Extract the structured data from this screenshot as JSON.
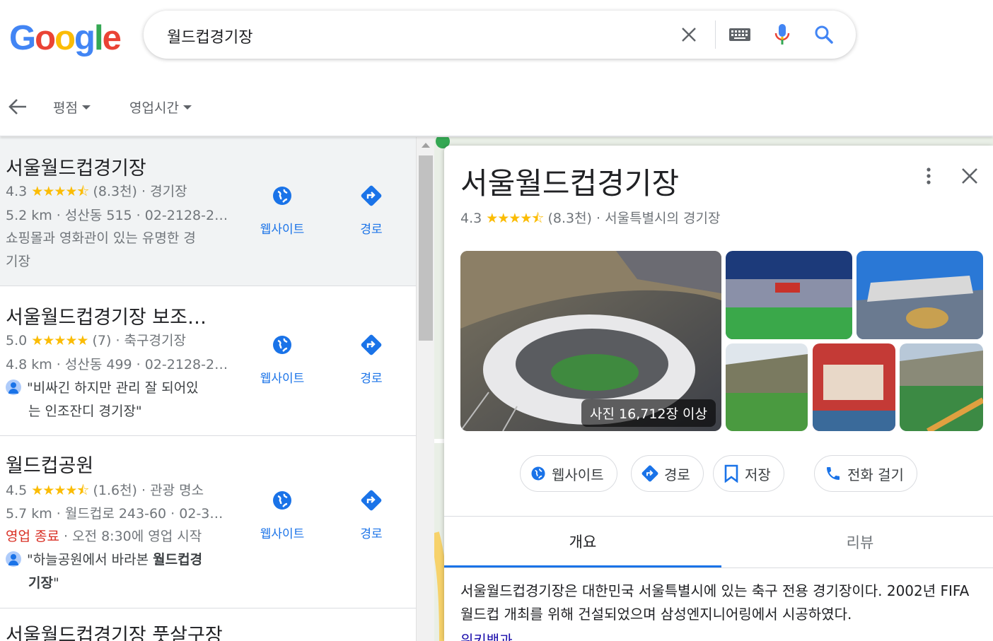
{
  "logo": {
    "letters": [
      "G",
      "o",
      "o",
      "g",
      "l",
      "e"
    ],
    "colors": [
      "#4285f4",
      "#ea4335",
      "#fbbc05",
      "#4285f4",
      "#34a853",
      "#ea4335"
    ]
  },
  "search": {
    "query": "월드컵경기장"
  },
  "filters": [
    {
      "label": "평점"
    },
    {
      "label": "영업시간"
    }
  ],
  "results": [
    {
      "title": "서울월드컵경기장",
      "rating": "4.3",
      "stars": "★★★★⯪",
      "reviews": "(8.3천)",
      "category": "· 경기장",
      "line2": "5.2 km · 성산동 515 · 02-2128-2…",
      "line3": "쇼핑몰과 영화관이 있는 유명한 경",
      "line4": "기장",
      "website": "웹사이트",
      "directions": "경로"
    },
    {
      "title": "서울월드컵경기장 보조…",
      "rating": "5.0",
      "stars": "★★★★★",
      "reviews": "(7)",
      "category": "· 축구경기장",
      "line2": "4.8 km · 성산동 499 · 02-2128-2…",
      "line3": "\"비싸긴 하지만 관리 잘 되어있",
      "line4": "는 인조잔디 경기장\"",
      "website": "웹사이트",
      "directions": "경로"
    },
    {
      "title": "월드컵공원",
      "rating": "4.5",
      "stars": "★★★★⯪",
      "reviews": "(1.6천)",
      "category": "· 관광 명소",
      "line2": "5.7 km · 월드컵로 243-60 · 02-3…",
      "closed": "영업 종료",
      "hours": " · 오전 8:30에 영업 시작",
      "line3a": "\"하늘공원에서 바라본 ",
      "line3b": "월드컵경",
      "line4": "기장",
      "line4end": "\"",
      "website": "웹사이트",
      "directions": "경로"
    },
    {
      "title": "서울월드컵경기장 풋살구장"
    }
  ],
  "panel": {
    "title": "서울월드컵경기장",
    "rating": "4.3",
    "stars": "★★★★⯪",
    "reviews": "(8.3천)",
    "category": "서울특별시의 경기장",
    "photo_count": "사진 16,712장 이상",
    "buttons": {
      "website": "웹사이트",
      "directions": "경로",
      "save": "저장",
      "call": "전화 걸기"
    },
    "tabs": {
      "overview": "개요",
      "reviews": "리뷰"
    },
    "description": "서울월드컵경기장은 대한민국 서울특별시에 있는 축구 전용 경기장이다. 2002년 FIFA 월드컵 개최를 위해 건설되었으며 삼성엔지니어링에서 시공하였다.",
    "source": "위키백과"
  }
}
